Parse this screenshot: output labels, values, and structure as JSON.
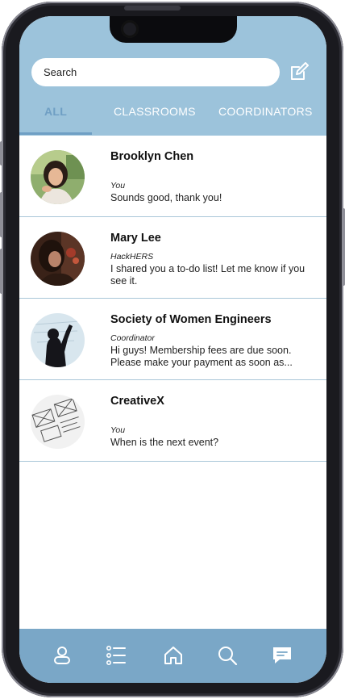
{
  "search": {
    "placeholder": "Search"
  },
  "tabs": [
    {
      "label": "ALL",
      "active": true
    },
    {
      "label": "CLASSROOMS",
      "active": false
    },
    {
      "label": "COORDINATORS",
      "active": false
    }
  ],
  "conversations": [
    {
      "name": "Brooklyn Chen",
      "sender": "You",
      "preview": "Sounds good, thank you!"
    },
    {
      "name": "Mary Lee",
      "sender": "HackHERS",
      "preview": "I shared you a to-do list! Let me know if you see it."
    },
    {
      "name": "Society of Women Engineers",
      "sender": "Coordinator",
      "preview": "Hi guys! Membership fees are due soon. Please make your payment as soon as..."
    },
    {
      "name": "CreativeX",
      "sender": "You",
      "preview": "When is the next event?"
    }
  ],
  "nav_icons": [
    "profile-icon",
    "list-icon",
    "home-icon",
    "search-icon",
    "chat-icon"
  ],
  "colors": {
    "header": "#9cc3db",
    "active_tab": "#6f9fc4",
    "bottom_nav": "#7aa7c7",
    "divider": "#a9c6d8"
  }
}
